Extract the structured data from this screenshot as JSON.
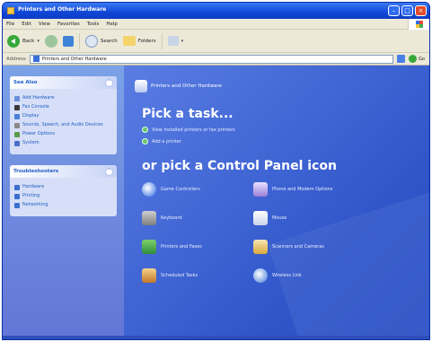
{
  "window": {
    "title": "Printers and Other Hardware"
  },
  "menubar": {
    "items": [
      "File",
      "Edit",
      "View",
      "Favorites",
      "Tools",
      "Help"
    ]
  },
  "toolbar": {
    "back_label": "Back",
    "search_label": "Search",
    "folders_label": "Folders"
  },
  "address": {
    "label": "Address",
    "value": "Printers and Other Hardware",
    "go_label": "Go"
  },
  "sidebar": {
    "see_also": {
      "title": "See Also",
      "items": [
        "Add Hardware",
        "Fax Console",
        "Display",
        "Sounds, Speech, and Audio Devices",
        "Power Options",
        "System"
      ]
    },
    "troubleshooters": {
      "title": "Troubleshooters",
      "items": [
        "Hardware",
        "Printing",
        "Networking"
      ]
    }
  },
  "main": {
    "category_title": "Printers and Other Hardware",
    "pick_task": "Pick a task...",
    "tasks": [
      "View installed printers or fax printers",
      "Add a printer"
    ],
    "pick_icon": "or pick a Control Panel icon",
    "icons": [
      {
        "label": "Game Controllers",
        "icon": "game-controller-icon"
      },
      {
        "label": "Phone and Modem Options",
        "icon": "phone-modem-icon"
      },
      {
        "label": "Keyboard",
        "icon": "keyboard-icon"
      },
      {
        "label": "Mouse",
        "icon": "mouse-icon"
      },
      {
        "label": "Printers and Faxes",
        "icon": "printer-icon"
      },
      {
        "label": "Scanners and Cameras",
        "icon": "scanner-camera-icon"
      },
      {
        "label": "Scheduled Tasks",
        "icon": "scheduled-tasks-icon"
      },
      {
        "label": "Wireless Link",
        "icon": "wireless-link-icon"
      }
    ]
  },
  "colors": {
    "titlebar": "#1147d6",
    "taskpane": "#7ba2e7",
    "main_bg": "#2f55c9",
    "panel_title": "#215dc6"
  }
}
